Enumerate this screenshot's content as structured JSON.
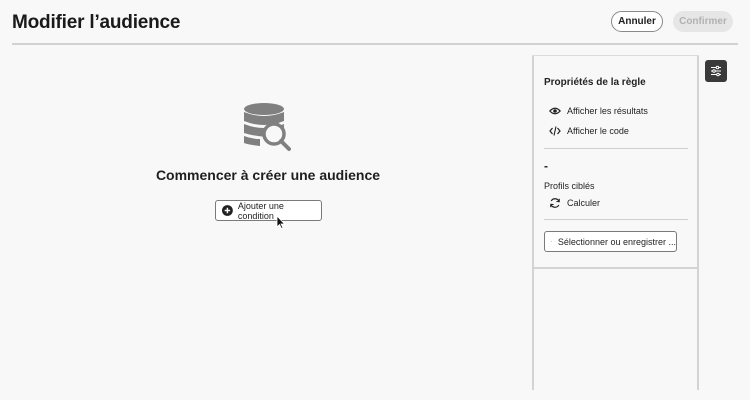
{
  "header": {
    "title": "Modifier l’audience",
    "cancel_label": "Annuler",
    "confirm_label": "Confirmer"
  },
  "canvas": {
    "empty_title": "Commencer à créer une audience",
    "add_condition_label": "Ajouter une condition",
    "icon": "database-search-icon"
  },
  "panel": {
    "title": "Propriétés de la règle",
    "show_results_label": "Afficher les résultats",
    "show_code_label": "Afficher le code",
    "profiles_value": "-",
    "profiles_label": "Profils ciblés",
    "compute_label": "Calculer",
    "select_save_label": "Sélectionner ou enregistrer ..."
  },
  "colors": {
    "background": "#f8f8f8",
    "dark_button": "#3a3a3a",
    "icon_gray": "#808080",
    "disabled_button": "#e6e6e6"
  }
}
